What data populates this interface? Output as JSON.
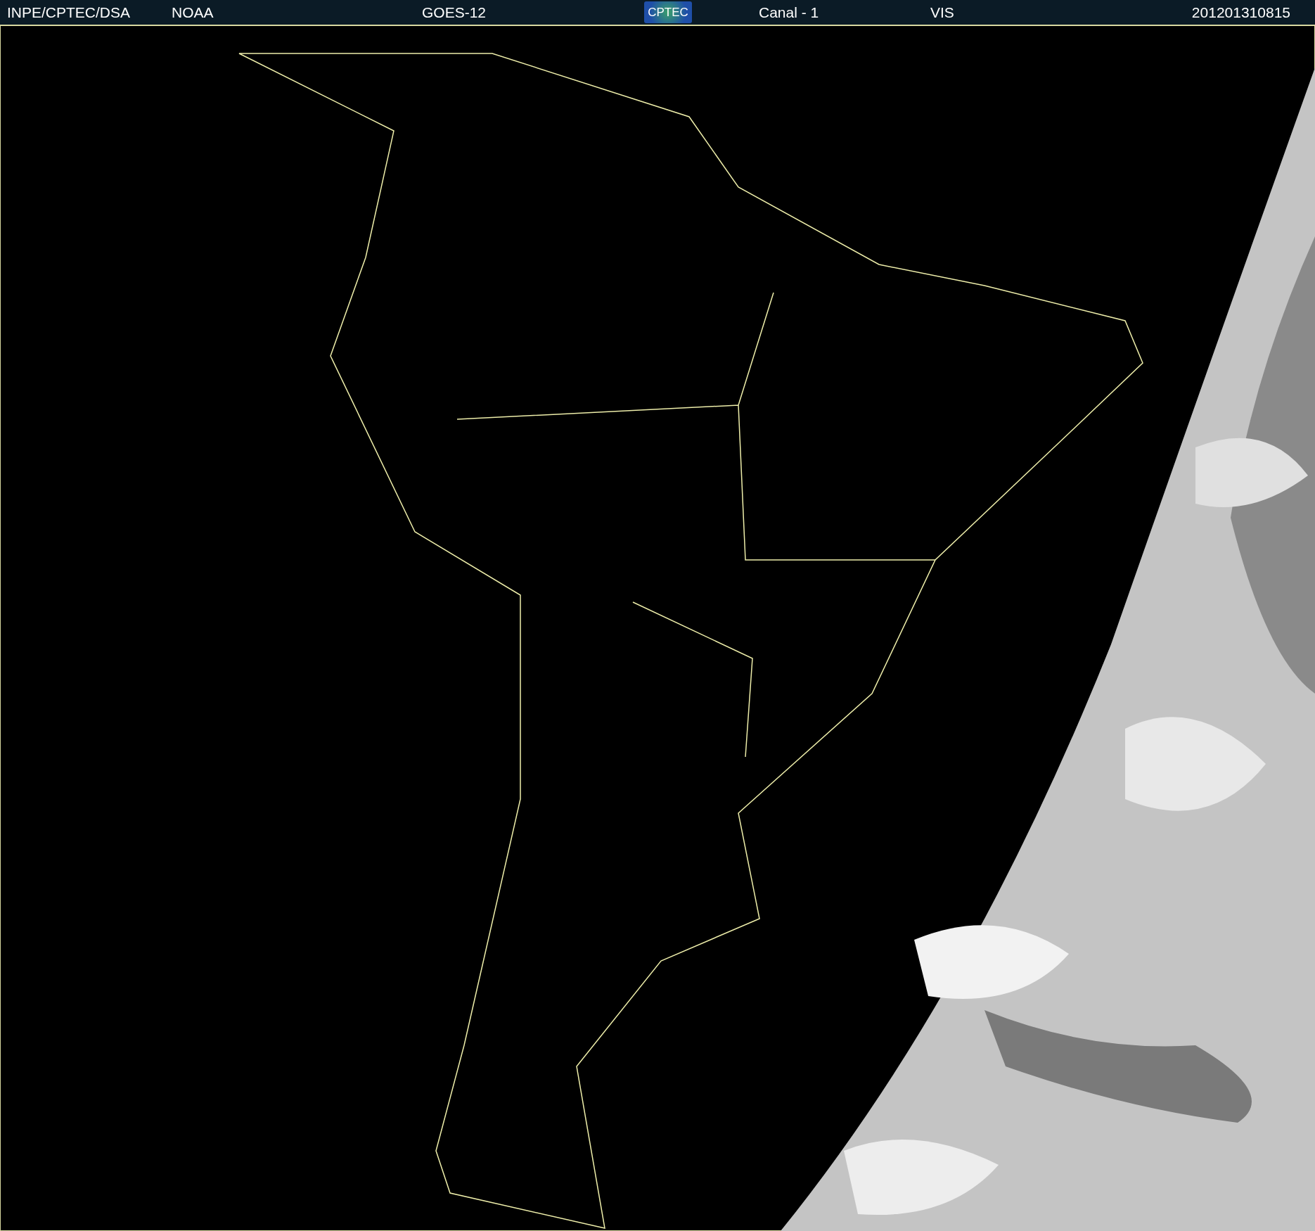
{
  "header": {
    "items": [
      {
        "kind": "text",
        "label": "INPE/CPTEC/DSA"
      },
      {
        "kind": "text",
        "label": "NOAA"
      },
      {
        "kind": "text",
        "label": "GOES-12"
      },
      {
        "kind": "logo",
        "label": "CPTEC"
      },
      {
        "kind": "text",
        "label": "Canal - 1"
      },
      {
        "kind": "text",
        "label": "VIS"
      },
      {
        "kind": "text",
        "label": "201201310815"
      }
    ]
  }
}
